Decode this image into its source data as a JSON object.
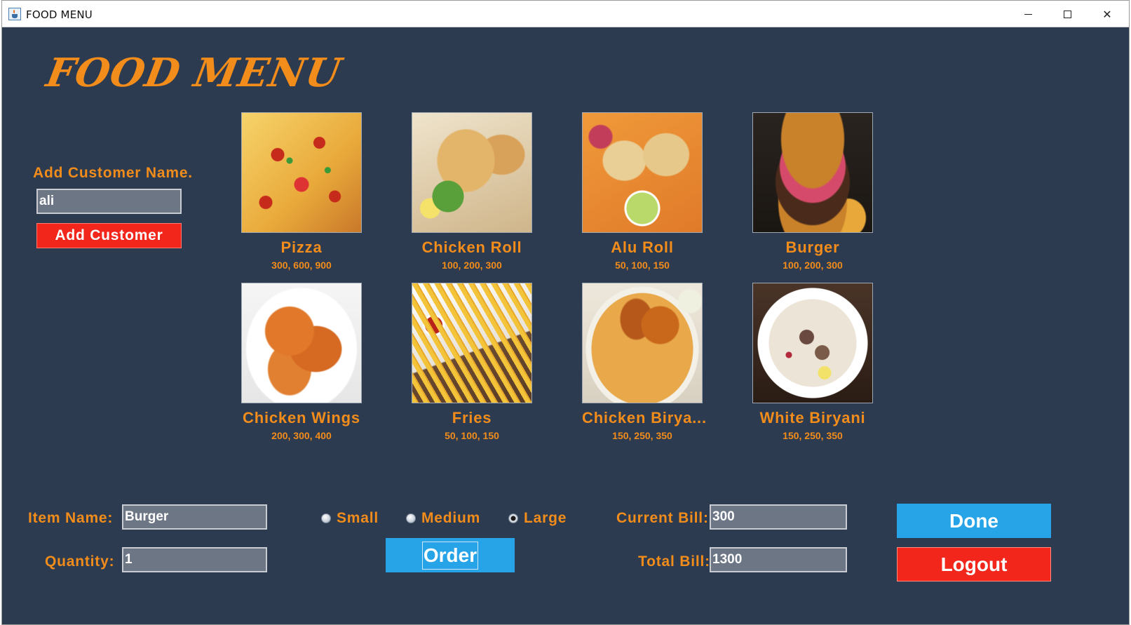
{
  "window": {
    "title": "FOOD MENU"
  },
  "heading": "FOOD MENU",
  "customer": {
    "label": "Add Customer Name.",
    "name_value": "ali",
    "add_button": "Add Customer"
  },
  "menu": {
    "items": [
      {
        "name": "Pizza",
        "prices": "300, 600, 900",
        "icon": "pizza-image"
      },
      {
        "name": "Chicken Roll",
        "prices": "100, 200, 300",
        "icon": "chicken-roll-image"
      },
      {
        "name": "Alu Roll",
        "prices": "50, 100, 150",
        "icon": "alu-roll-image"
      },
      {
        "name": "Burger",
        "prices": "100, 200, 300",
        "icon": "burger-image"
      },
      {
        "name": "Chicken Wings",
        "prices": "200, 300, 400",
        "icon": "chicken-wings-image"
      },
      {
        "name": "Fries",
        "prices": "50, 100, 150",
        "icon": "fries-image"
      },
      {
        "name": "Chicken Birya...",
        "prices": "150, 250, 350",
        "icon": "chicken-biryani-image"
      },
      {
        "name": "White Biryani",
        "prices": "150, 250, 350",
        "icon": "white-biryani-image"
      }
    ]
  },
  "order": {
    "item_label": "Item Name:",
    "item_value": "Burger",
    "quantity_label": "Quantity:",
    "quantity_value": "1",
    "sizes": [
      {
        "label": "Small",
        "selected": false
      },
      {
        "label": "Medium",
        "selected": false
      },
      {
        "label": "Large",
        "selected": true
      }
    ],
    "order_button": "Order"
  },
  "bill": {
    "current_label": "Current Bill:",
    "current_value": "300",
    "total_label": "Total Bill:",
    "total_value": "1300"
  },
  "actions": {
    "done": "Done",
    "logout": "Logout"
  },
  "colors": {
    "background": "#2d3b50",
    "accent_orange": "#f28c1a",
    "button_red": "#f2261b",
    "button_blue": "#27a4e8",
    "field_gray": "#6c7685"
  }
}
